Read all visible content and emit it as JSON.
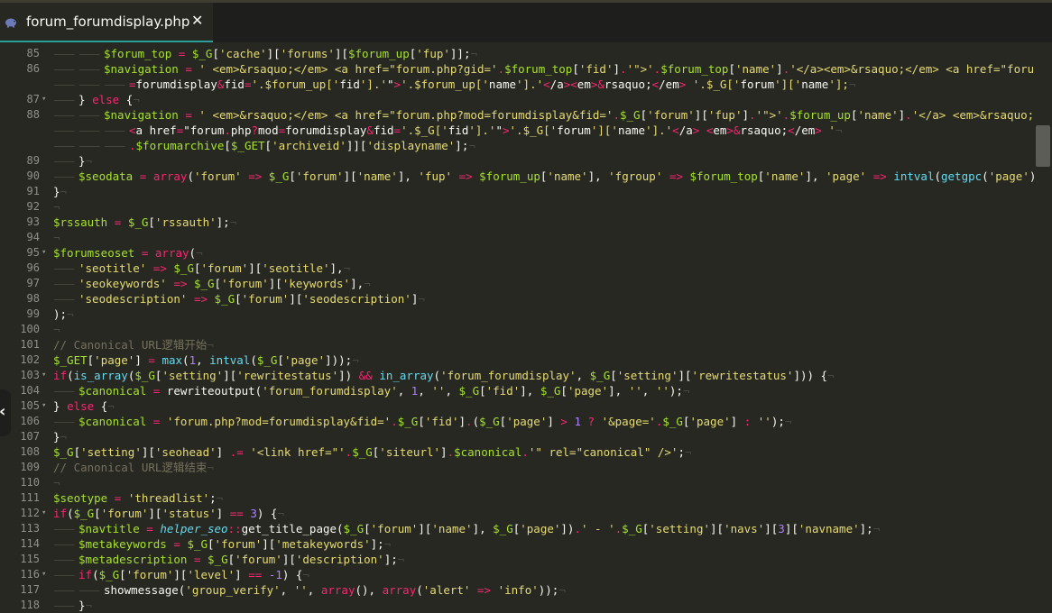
{
  "tab": {
    "title": "forum_forumdisplay.php",
    "close_glyph": "✕",
    "icon": "php-elephant-icon"
  },
  "side_handle_glyph": "‹",
  "code_lines": [
    {
      "ln": "85",
      "indent": 2,
      "text": "$forum_top = $_G['cache']['forums'][$forum_up['fup']];"
    },
    {
      "ln": "86",
      "indent": 2,
      "text": "$navigation = ' <em>&rsaquo;</em> <a href=\"forum.php?gid='.$forum_top['fid'].'\">'.$forum_top['name'].'</a><em>&rsaquo;</em> <a href=\"forum.php?mod"
    },
    {
      "ln": "",
      "indent": 3,
      "text": "=forumdisplay&fid='.$forum_up['fid'].'\">'.$forum_up['name'].'</a><em>&rsaquo;</em> '.$_G['forum']['name'];"
    },
    {
      "ln": "87",
      "fold": true,
      "indent": 1,
      "text": "} else {"
    },
    {
      "ln": "88",
      "indent": 2,
      "text": "$navigation = ' <em>&rsaquo;</em> <a href=\"forum.php?mod=forumdisplay&fid='.$_G['forum']['fup'].'\">'.$forum_up['name'].'</a> <em>&rsaquo;</em> '.'"
    },
    {
      "ln": "",
      "indent": 3,
      "text": "<a href=\"forum.php?mod=forumdisplay&fid='.$_G['fid'].'\">'.$_G['forum']['name'].'</a> <em>&rsaquo;</em> '"
    },
    {
      "ln": "",
      "indent": 3,
      "text": ".$forumarchive[$_GET['archiveid']]['displayname'];"
    },
    {
      "ln": "89",
      "indent": 1,
      "text": "}"
    },
    {
      "ln": "90",
      "indent": 1,
      "text": "$seodata = array('forum' => $_G['forum']['name'], 'fup' => $forum_up['name'], 'fgroup' => $forum_top['name'], 'page' => intval(getgpc('page')));"
    },
    {
      "ln": "91",
      "indent": 0,
      "text": "}"
    },
    {
      "ln": "92",
      "indent": 0,
      "text": ""
    },
    {
      "ln": "93",
      "indent": 0,
      "text": "$rssauth = $_G['rssauth'];"
    },
    {
      "ln": "94",
      "indent": 0,
      "text": ""
    },
    {
      "ln": "95",
      "fold": true,
      "indent": 0,
      "text": "$forumseoset = array("
    },
    {
      "ln": "96",
      "indent": 1,
      "text": "'seotitle' => $_G['forum']['seotitle'],"
    },
    {
      "ln": "97",
      "indent": 1,
      "text": "'seokeywords' => $_G['forum']['keywords'],"
    },
    {
      "ln": "98",
      "indent": 1,
      "text": "'seodescription' => $_G['forum']['seodescription']"
    },
    {
      "ln": "99",
      "indent": 0,
      "text": ");"
    },
    {
      "ln": "100",
      "indent": 0,
      "text": ""
    },
    {
      "ln": "101",
      "indent": 0,
      "text": "// Canonical URL逻辑开始"
    },
    {
      "ln": "102",
      "indent": 0,
      "text": "$_GET['page'] = max(1, intval($_G['page']));"
    },
    {
      "ln": "103",
      "fold": true,
      "indent": 0,
      "text": "if(is_array($_G['setting']['rewritestatus']) && in_array('forum_forumdisplay', $_G['setting']['rewritestatus'])) {"
    },
    {
      "ln": "104",
      "indent": 1,
      "text": "$canonical = rewriteoutput('forum_forumdisplay', 1, '', $_G['fid'], $_G['page'], '', '');"
    },
    {
      "ln": "105",
      "fold": true,
      "indent": 0,
      "text": "} else {"
    },
    {
      "ln": "106",
      "indent": 1,
      "text": "$canonical = 'forum.php?mod=forumdisplay&fid='.$_G['fid'].($_G['page'] > 1 ? '&page='.$_G['page'] : '');"
    },
    {
      "ln": "107",
      "indent": 0,
      "text": "}"
    },
    {
      "ln": "108",
      "indent": 0,
      "text": "$_G['setting']['seohead'] .= '<link href=\"'.$_G['siteurl'].$canonical.'\" rel=\"canonical\" />';"
    },
    {
      "ln": "109",
      "indent": 0,
      "text": "// Canonical URL逻辑结束"
    },
    {
      "ln": "110",
      "indent": 0,
      "text": ""
    },
    {
      "ln": "111",
      "indent": 0,
      "text": "$seotype = 'threadlist';"
    },
    {
      "ln": "112",
      "fold": true,
      "indent": 0,
      "text": "if($_G['forum']['status'] == 3) {"
    },
    {
      "ln": "113",
      "indent": 1,
      "text": "$navtitle = helper_seo::get_title_page($_G['forum']['name'], $_G['page']).' - '.$_G['setting']['navs'][3]['navname'];"
    },
    {
      "ln": "114",
      "indent": 1,
      "text": "$metakeywords = $_G['forum']['metakeywords'];"
    },
    {
      "ln": "115",
      "indent": 1,
      "text": "$metadescription = $_G['forum']['description'];"
    },
    {
      "ln": "116",
      "fold": true,
      "indent": 1,
      "text": "if($_G['forum']['level'] == -1) {"
    },
    {
      "ln": "117",
      "indent": 2,
      "text": "showmessage('group_verify', '', array(), array('alert' => 'info'));"
    },
    {
      "ln": "118",
      "indent": 1,
      "text": "}"
    }
  ],
  "colors": {
    "background": "#272822",
    "tab_accent": "#2aa198",
    "string": "#e6db74",
    "keyword": "#f92672",
    "function": "#66d9ef",
    "comment": "#75715e",
    "number": "#ae81ff",
    "variable": "#a6e22e"
  }
}
